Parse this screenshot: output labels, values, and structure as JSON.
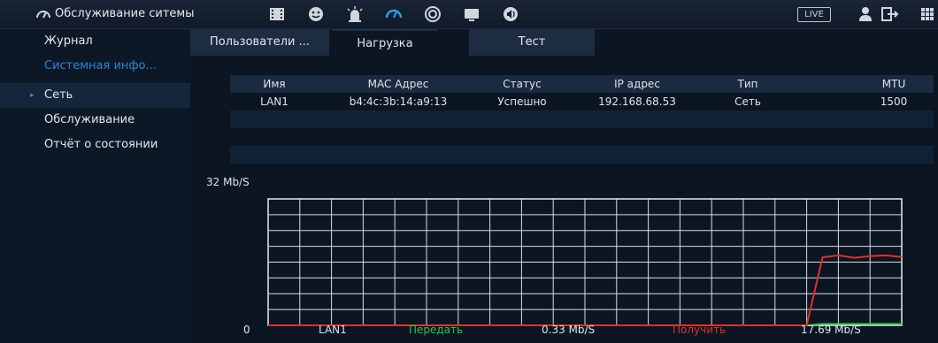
{
  "app": {
    "title": "Обслуживание ситемы",
    "live_label": "LIVE"
  },
  "icons": {
    "app": "speedometer-icon",
    "top": [
      "film-icon",
      "face-icon",
      "alarm-icon",
      "speedometer-icon",
      "disc-icon",
      "monitor-icon",
      "speaker-icon"
    ],
    "right": [
      "user-icon",
      "logout-icon",
      "grid-icon"
    ]
  },
  "sidebar": {
    "items": [
      {
        "label": "Журнал"
      },
      {
        "label": "Системная инфо..."
      },
      {
        "label": "Сеть"
      },
      {
        "label": "Обслуживание"
      },
      {
        "label": "Отчёт о состоянии"
      }
    ]
  },
  "tabs": [
    {
      "label": "Пользователи ..."
    },
    {
      "label": "Нагрузка"
    },
    {
      "label": "Тест"
    }
  ],
  "table": {
    "headers": [
      "Имя",
      "MAC Адрес",
      "Статус",
      "IP адрес",
      "Тип",
      "MTU"
    ],
    "rows": [
      [
        "LAN1",
        "b4:4c:3b:14:a9:13",
        "Успешно",
        "192.168.68.53",
        "Сеть",
        "1500"
      ]
    ]
  },
  "chart": {
    "ymax_label": "32 Mb/S",
    "ymin_label": "0"
  },
  "chart_data": {
    "type": "line",
    "ylim": [
      0,
      32
    ],
    "grid": true,
    "x": [
      0,
      1,
      2,
      3,
      4,
      5,
      6,
      7,
      8,
      9,
      10,
      11,
      12,
      13,
      14,
      15,
      16,
      17,
      18,
      19,
      20,
      21,
      22,
      23,
      24,
      25,
      26,
      27,
      28,
      29,
      30,
      31,
      32,
      33,
      34,
      35,
      36,
      37,
      38,
      39,
      40
    ],
    "series": [
      {
        "name": "Передать",
        "color": "#2ec24a",
        "values": [
          0,
          0,
          0,
          0,
          0,
          0,
          0,
          0,
          0,
          0,
          0,
          0,
          0,
          0,
          0,
          0,
          0,
          0,
          0,
          0,
          0,
          0,
          0,
          0,
          0,
          0,
          0,
          0,
          0,
          0,
          0,
          0,
          0,
          0,
          0,
          0.33,
          0.33,
          0.33,
          0.33,
          0.33,
          0.33
        ]
      },
      {
        "name": "Получить",
        "color": "#e0302c",
        "values": [
          0,
          0,
          0,
          0,
          0,
          0,
          0,
          0,
          0,
          0,
          0,
          0,
          0,
          0,
          0,
          0,
          0,
          0,
          0,
          0,
          0,
          0,
          0,
          0,
          0,
          0,
          0,
          0,
          0,
          0,
          0,
          0,
          0,
          0,
          0,
          17.2,
          17.69,
          17.1,
          17.5,
          17.69,
          17.3
        ]
      }
    ]
  },
  "legend": {
    "interface": "LAN1",
    "tx_label": "Передать",
    "tx_value": "0.33 Mb/S",
    "rx_label": "Получить",
    "rx_value": "17.69 Mb/S",
    "tx_color": "#2ec24a",
    "rx_color": "#e0302c"
  }
}
